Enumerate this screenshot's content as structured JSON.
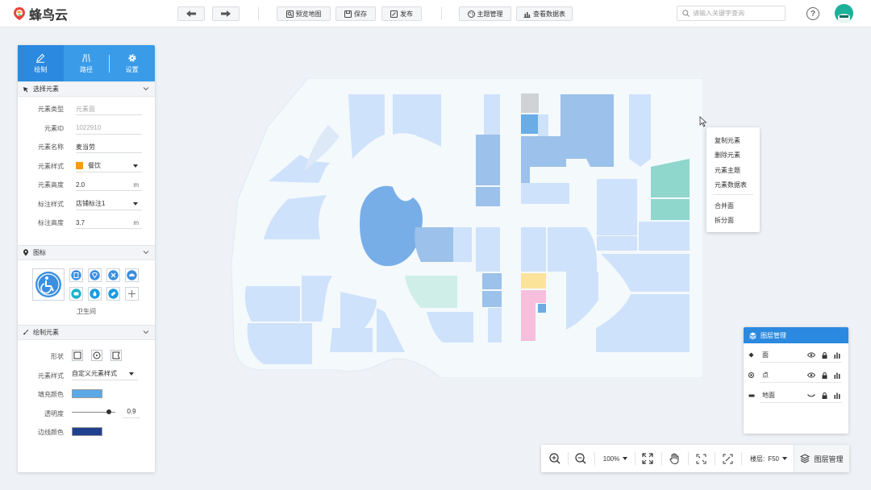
{
  "header": {
    "brand": "蜂鸟云",
    "buttons": {
      "preview": "预览地图",
      "save": "保存",
      "publish": "发布",
      "theme": "主题管理",
      "datatable": "查看数据表"
    },
    "search_placeholder": "请输入关键字查询",
    "help": "?"
  },
  "left_panel": {
    "tabs": [
      {
        "label": "绘制",
        "icon": "pencil-icon"
      },
      {
        "label": "路径",
        "icon": "path-icon"
      },
      {
        "label": "设置",
        "icon": "gear-icon"
      }
    ],
    "select_section": {
      "title": "选择元素",
      "fields": [
        {
          "label": "元素类型",
          "value": "元素面",
          "placeholder": true
        },
        {
          "label": "元素ID",
          "value": "1022910",
          "placeholder": true
        },
        {
          "label": "元素名称",
          "value": "麦当劳"
        },
        {
          "label": "元素样式",
          "value": "餐饮",
          "swatch": "#f39c12",
          "dropdown": true
        },
        {
          "label": "元素高度",
          "value": "2.0",
          "unit": "m"
        },
        {
          "label": "标注样式",
          "value": "店铺标注1",
          "dropdown": true
        },
        {
          "label": "标注高度",
          "value": "3.7",
          "unit": "m"
        }
      ]
    },
    "icon_section": {
      "title": "图标",
      "selected_caption": "卫生间"
    },
    "draw_section": {
      "title": "绘制元素",
      "shape_label": "形状",
      "style_label": "元素样式",
      "style_value": "自定义元素样式",
      "fill_label": "填充颜色",
      "fill_color": "#5aa9e6",
      "opacity_label": "透明度",
      "opacity_value": "0.9",
      "stroke_label": "边线颜色",
      "stroke_color": "#1f3f8f"
    }
  },
  "context_menu": {
    "items": [
      "复制元素",
      "删除元素",
      "元素主题",
      "元素数据表"
    ],
    "items2": [
      "合并面",
      "拆分面"
    ]
  },
  "layer_panel": {
    "title": "图层管理",
    "rows": [
      {
        "name": "面",
        "icon": "polygon-layer-icon"
      },
      {
        "name": "点",
        "icon": "point-layer-icon"
      },
      {
        "name": "地面",
        "icon": "ground-layer-icon"
      }
    ]
  },
  "bottom_bar": {
    "zoom": "100%",
    "floor_label": "楼层:",
    "floor_value": "F50",
    "layer_button": "图层管理"
  },
  "colors": {
    "primary": "#2b8ae0",
    "map_light": "#cfe2fb",
    "map_mid": "#9cc1ea",
    "map_dark": "#78aee8",
    "teal": "#8fd6cc",
    "pink": "#f7bfdc",
    "yellow": "#fbe39a"
  }
}
